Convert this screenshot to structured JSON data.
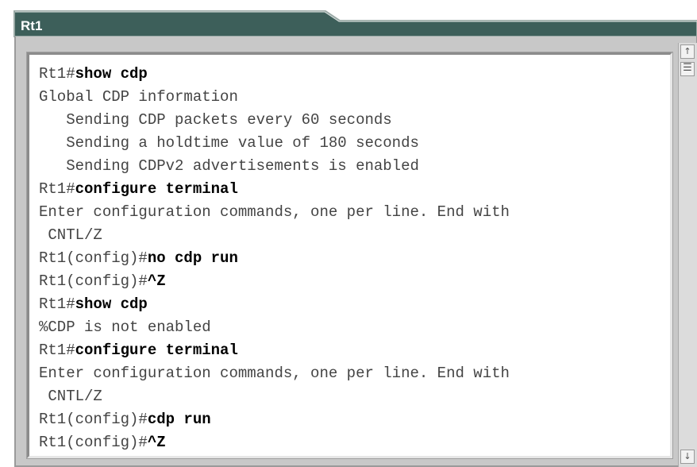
{
  "window": {
    "title": "Rt1"
  },
  "colors": {
    "header": "#3d5f5a",
    "frame": "#c8c8c8",
    "terminal_bg": "#ffffff",
    "output_text": "#444444",
    "command_text": "#000000"
  },
  "scrollbar": {
    "up_icon": "↑",
    "thumb_icon": "☰",
    "down_icon": "↓"
  },
  "terminal": {
    "lines": [
      {
        "prompt": "Rt1#",
        "command": "show cdp"
      },
      {
        "output": "Global CDP information"
      },
      {
        "output": "   Sending CDP packets every 60 seconds"
      },
      {
        "output": "   Sending a holdtime value of 180 seconds"
      },
      {
        "output": "   Sending CDPv2 advertisements is enabled"
      },
      {
        "prompt": "Rt1#",
        "command": "configure terminal"
      },
      {
        "output": "Enter configuration commands, one per line. End with"
      },
      {
        "output": " CNTL/Z"
      },
      {
        "prompt": "Rt1(config)#",
        "command": "no cdp run"
      },
      {
        "prompt": "Rt1(config)#",
        "command": "^Z"
      },
      {
        "prompt": "Rt1#",
        "command": "show cdp"
      },
      {
        "output": "%CDP is not enabled"
      },
      {
        "prompt": "Rt1#",
        "command": "configure terminal"
      },
      {
        "output": "Enter configuration commands, one per line. End with"
      },
      {
        "output": " CNTL/Z"
      },
      {
        "prompt": "Rt1(config)#",
        "command": "cdp run"
      },
      {
        "prompt": "Rt1(config)#",
        "command": "^Z"
      }
    ]
  }
}
